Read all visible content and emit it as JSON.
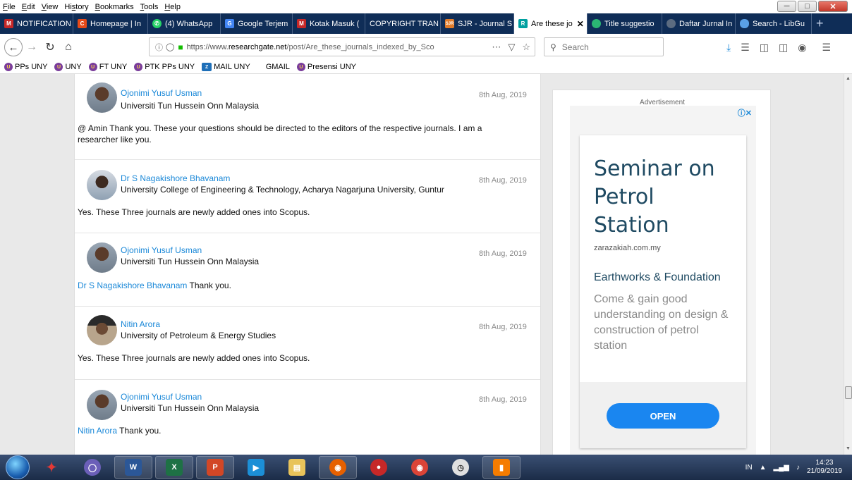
{
  "menubar": {
    "items": [
      "File",
      "Edit",
      "View",
      "History",
      "Bookmarks",
      "Tools",
      "Help"
    ]
  },
  "tabs": [
    {
      "label": "NOTIFICATION",
      "color": "#c62828",
      "glyph": "M"
    },
    {
      "label": "Homepage | In",
      "color": "#e64a19",
      "glyph": "C"
    },
    {
      "label": "(4) WhatsApp",
      "color": "#25d366",
      "glyph": "W"
    },
    {
      "label": "Google Terjem",
      "color": "#4285f4",
      "glyph": "G"
    },
    {
      "label": "Kotak Masuk (",
      "color": "#c62828",
      "glyph": "M"
    },
    {
      "label": "COPYRIGHT TRAN",
      "color": "#0f2d57",
      "glyph": ""
    },
    {
      "label": "SJR - Journal S",
      "color": "#e07b2a",
      "glyph": "SJR"
    },
    {
      "label": "Are these jo",
      "color": "#00a0a0",
      "glyph": "R"
    },
    {
      "label": "Title suggestio",
      "color": "#2bb673",
      "glyph": ""
    },
    {
      "label": "Daftar Jurnal In",
      "color": "#5b6b80",
      "glyph": ""
    },
    {
      "label": "Search - LibGu",
      "color": "#5aa0e6",
      "glyph": ""
    }
  ],
  "navbar": {
    "url_prefix": "https://www.",
    "url_domain": "researchgate.net",
    "url_rest": "/post/Are_these_journals_indexed_by_Sco",
    "search_placeholder": "Search"
  },
  "bookmarks": [
    {
      "label": "PPs UNY",
      "type": "uny"
    },
    {
      "label": "UNY",
      "type": "uny"
    },
    {
      "label": "FT UNY",
      "type": "uny"
    },
    {
      "label": "PTK PPs UNY",
      "type": "uny"
    },
    {
      "label": "MAIL UNY",
      "type": "mail"
    },
    {
      "label": "GMAIL",
      "type": "none"
    },
    {
      "label": "Presensi UNY",
      "type": "uny"
    }
  ],
  "posts": [
    {
      "author": "Ojonimi Yusuf Usman",
      "affiliation": "Universiti Tun Hussein Onn Malaysia",
      "date": "8th Aug, 2019",
      "mention": "",
      "text": "@ Amin Thank you. These your questions should be directed to the editors of the respective journals. I am a researcher like you."
    },
    {
      "author": "Dr S Nagakishore Bhavanam",
      "affiliation": "University College of Engineering & Technology, Acharya Nagarjuna University, Guntur",
      "date": "8th Aug, 2019",
      "mention": "",
      "text": "Yes. These Three journals are newly added ones into Scopus."
    },
    {
      "author": "Ojonimi Yusuf Usman",
      "affiliation": "Universiti Tun Hussein Onn Malaysia",
      "date": "8th Aug, 2019",
      "mention": "Dr S Nagakishore Bhavanam",
      "text": " Thank you."
    },
    {
      "author": "Nitin Arora",
      "affiliation": "University of Petroleum & Energy Studies",
      "date": "8th Aug, 2019",
      "mention": "",
      "text": "Yes. These Three journals are newly added ones into Scopus."
    },
    {
      "author": "Ojonimi Yusuf Usman",
      "affiliation": "Universiti Tun Hussein Onn Malaysia",
      "date": "8th Aug, 2019",
      "mention": "Nitin Arora",
      "text": " Thank you."
    }
  ],
  "ad": {
    "label": "Advertisement",
    "title": "Seminar on Petrol Station",
    "domain": "zarazakiah.com.my",
    "headline": "Earthworks & Foundation",
    "body": "Come & gain good understanding on design & construction of petrol station",
    "cta": "OPEN"
  },
  "taskbar": {
    "language": "IN",
    "time": "14:23",
    "date": "21/09/2019"
  }
}
